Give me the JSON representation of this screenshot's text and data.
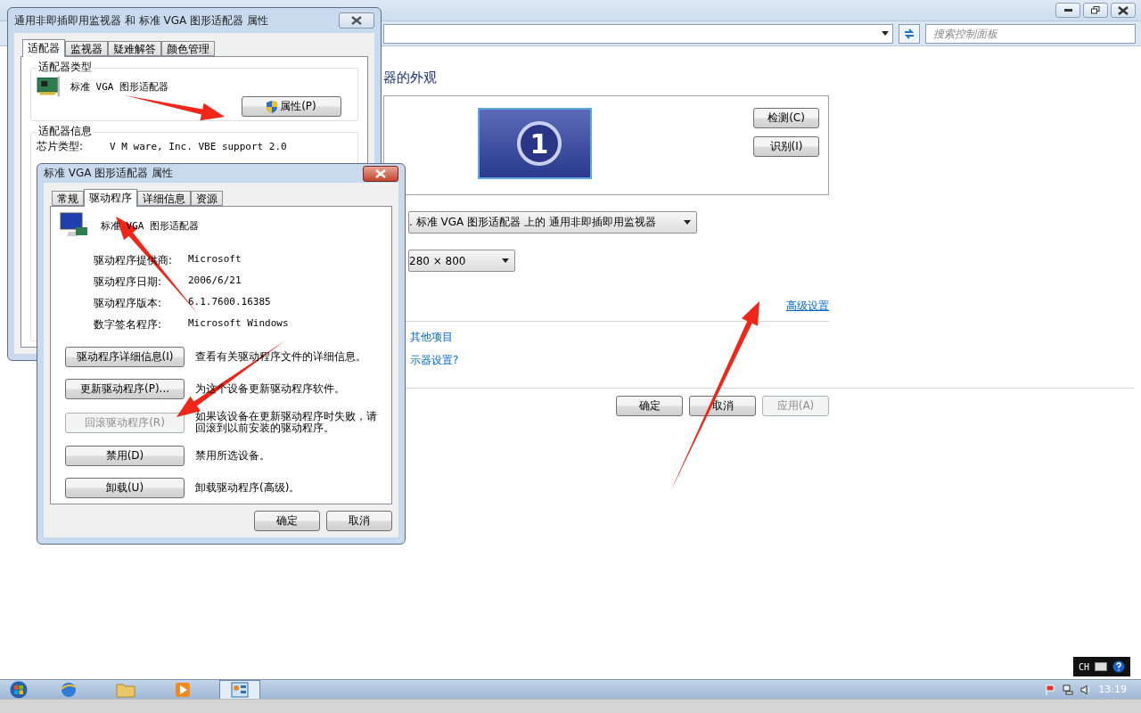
{
  "control_panel": {
    "search": {
      "placeholder": "搜索控制面板"
    },
    "heading": "器的外观",
    "monitor_number": "1",
    "buttons": [
      {
        "label": "检测(C)"
      },
      {
        "label": "识别(I)"
      }
    ],
    "display_select": {
      "value": ". 标准 VGA 图形适配器 上的 通用非即插即用监视器"
    },
    "resolution_select": {
      "value": "280 × 800"
    },
    "advanced_link": "高级设置",
    "links": [
      "其他项目",
      "示器设置?"
    ],
    "footer_buttons": [
      {
        "label": "确定",
        "disabled": false
      },
      {
        "label": "取消",
        "disabled": false
      },
      {
        "label": "应用(A)",
        "disabled": true
      }
    ]
  },
  "adapter_dialog": {
    "title": "通用非即插即用监视器 和 标准 VGA 图形适配器 属性",
    "tabs": [
      {
        "label": "适配器",
        "selected": true
      },
      {
        "label": "监视器",
        "selected": false
      },
      {
        "label": "疑难解答",
        "selected": false
      },
      {
        "label": "颜色管理",
        "selected": false
      }
    ],
    "type_group": "适配器类型",
    "adapter_name": "标准 VGA 图形适配器",
    "properties_button": "属性(P)",
    "info_group": "适配器信息",
    "chip_label": "芯片类型:",
    "chip_value": "V M ware, Inc. VBE support 2.0"
  },
  "driver_dialog": {
    "title": "标准 VGA 图形适配器 属性",
    "tabs": [
      {
        "label": "常规",
        "selected": false
      },
      {
        "label": "驱动程序",
        "selected": true
      },
      {
        "label": "详细信息",
        "selected": false
      },
      {
        "label": "资源",
        "selected": false
      }
    ],
    "device_name": "标准 VGA 图形适配器",
    "info": [
      {
        "label": "驱动程序提供商:",
        "value": "Microsoft"
      },
      {
        "label": "驱动程序日期:",
        "value": "2006/6/21"
      },
      {
        "label": "驱动程序版本:",
        "value": "6.1.7600.16385"
      },
      {
        "label": "数字签名程序:",
        "value": "Microsoft Windows"
      }
    ],
    "actions": [
      {
        "label": "驱动程序详细信息(I)",
        "description": "查看有关驱动程序文件的详细信息。",
        "disabled": false
      },
      {
        "label": "更新驱动程序(P)...",
        "description": "为这个设备更新驱动程序软件。",
        "disabled": false
      },
      {
        "label": "回滚驱动程序(R)",
        "description": "如果该设备在更新驱动程序时失败，请回滚到以前安装的驱动程序。",
        "disabled": true
      },
      {
        "label": "禁用(D)",
        "description": "禁用所选设备。",
        "disabled": false
      },
      {
        "label": "卸载(U)",
        "description": "卸载驱动程序(高级)。",
        "disabled": false
      }
    ],
    "footer_buttons": [
      {
        "label": "确定"
      },
      {
        "label": "取消"
      }
    ]
  },
  "taskbar": {
    "apps": [
      {
        "kind": "browser",
        "selected": false
      },
      {
        "kind": "folder",
        "selected": false
      },
      {
        "kind": "media",
        "selected": false
      },
      {
        "kind": "control-panel",
        "selected": true
      }
    ],
    "language": "CH",
    "time": "13:19"
  }
}
